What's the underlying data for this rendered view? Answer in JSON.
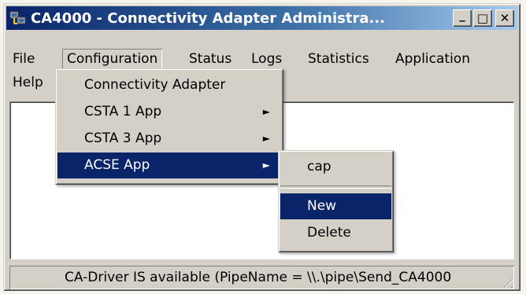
{
  "window": {
    "title": "CA4000 - Connectivity Adapter Administra...",
    "minimize_glyph": "_",
    "maximize_glyph": "□",
    "close_glyph": "✕"
  },
  "menubar": {
    "items": [
      {
        "label": "File"
      },
      {
        "label": "Configuration"
      },
      {
        "label": "Status"
      },
      {
        "label": "Logs"
      },
      {
        "label": "Statistics"
      },
      {
        "label": "Application"
      },
      {
        "label": "Help"
      }
    ]
  },
  "configuration_menu": {
    "items": [
      {
        "label": "Connectivity Adapter",
        "has_submenu": false
      },
      {
        "label": "CSTA 1  App",
        "has_submenu": true
      },
      {
        "label": "CSTA 3  App",
        "has_submenu": true
      },
      {
        "label": "ACSE App",
        "has_submenu": true,
        "highlighted": true
      }
    ],
    "arrow_glyph": "►"
  },
  "acse_submenu": {
    "items": [
      {
        "label": "cap"
      },
      {
        "label": "New",
        "highlighted": true
      },
      {
        "label": "Delete"
      }
    ]
  },
  "statusbar": {
    "text": "CA-Driver IS available (PipeName = \\\\.\\pipe\\Send_CA4000"
  },
  "colors": {
    "titlebar_start": "#0a246a",
    "titlebar_end": "#a6caf0",
    "highlight": "#0a246a",
    "face": "#d4d0c8"
  }
}
